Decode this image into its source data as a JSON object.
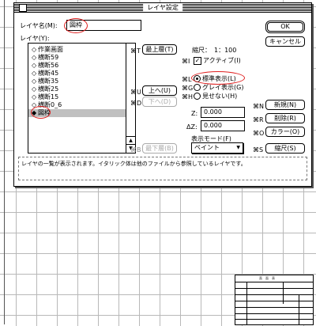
{
  "dialog": {
    "title": "レイヤ設定",
    "layer_name_label": "レイヤ名(M):",
    "layer_name_value": "図枠",
    "layer_list_label": "レイヤ(Y):",
    "layers": [
      {
        "name": "作業画面",
        "selected": false
      },
      {
        "name": "横断59",
        "selected": false
      },
      {
        "name": "横断56",
        "selected": false
      },
      {
        "name": "横断45",
        "selected": false
      },
      {
        "name": "横断35",
        "selected": false
      },
      {
        "name": "横断25",
        "selected": false
      },
      {
        "name": "横断15",
        "selected": false
      },
      {
        "name": "横断0_6",
        "selected": false
      },
      {
        "name": "図枠",
        "selected": true
      }
    ],
    "ok_label": "OK",
    "cancel_label": "キャンセル",
    "shortcut_top": "⌘T",
    "top_button": "最上層(T)",
    "shortcut_up": "⌘U",
    "up_button": "上へ(U)",
    "shortcut_down": "⌘D",
    "down_button": "下へ(D)",
    "shortcut_bottom": "⌘B",
    "bottom_button": "最下層(B)",
    "scale_label": "縮尺：",
    "scale_value": "1：100",
    "shortcut_active": "⌘I",
    "active_label": "アクティブ(I)",
    "shortcut_standard": "⌘L",
    "standard_label": "標準表示(L)",
    "shortcut_gray": "⌘G",
    "gray_label": "グレイ表示(G)",
    "shortcut_hidden": "⌘H",
    "hidden_label": "見せない(H)",
    "z_label": "Z:",
    "z_value": "0.000",
    "dz_label": "ΔZ:",
    "dz_value": "0.000",
    "display_mode_label": "表示モード(F)",
    "display_mode_value": "ペイント",
    "shortcut_new": "⌘N",
    "new_button": "新規(N)",
    "shortcut_delete": "⌘R",
    "delete_button": "削除(R)",
    "shortcut_color": "⌘O",
    "color_button": "カラー(O)",
    "shortcut_scale": "⌘S",
    "scale_button": "縮尺(S)",
    "message": "レイヤの一覧が表示されます。イタリック体は他のファイルから参照しているレイヤです。"
  },
  "title_block": {
    "header": "直　面　表"
  },
  "colors": {
    "annotation_circle": "#e02020",
    "selection": "#c0c0c0",
    "grid": "#b8b8b8"
  }
}
